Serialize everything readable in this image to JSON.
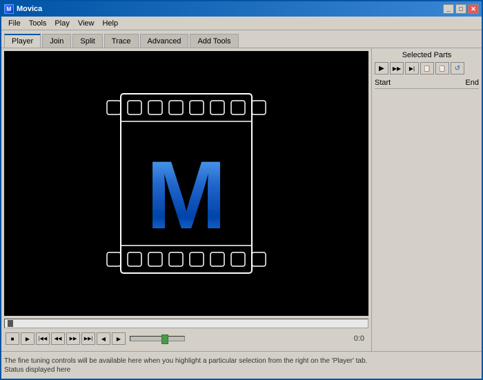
{
  "window": {
    "title": "Movica",
    "icon": "M"
  },
  "window_controls": {
    "minimize": "_",
    "maximize": "□",
    "close": "✕"
  },
  "menu": {
    "items": [
      "File",
      "Tools",
      "Play",
      "View",
      "Help"
    ]
  },
  "tabs": {
    "items": [
      "Player",
      "Join",
      "Split",
      "Trace",
      "Advanced",
      "Add Tools"
    ],
    "active": "Player"
  },
  "right_panel": {
    "title": "Selected Parts",
    "toolbar_buttons": [
      "▶",
      "▶▶",
      "▶|",
      "📋",
      "📋",
      "↺"
    ],
    "columns": {
      "start": "Start",
      "end": "End"
    }
  },
  "transport": {
    "time": "0:0",
    "buttons": [
      "■",
      "▶",
      "|◀◀",
      "◀◀",
      "▶▶",
      "▶▶|"
    ],
    "volume_left": "◀",
    "volume_right": "▶"
  },
  "status": {
    "hint": "The fine tuning controls will be available here when you highlight a particular selection from the right on the 'Player' tab.",
    "status_text": "Status displayed here"
  }
}
